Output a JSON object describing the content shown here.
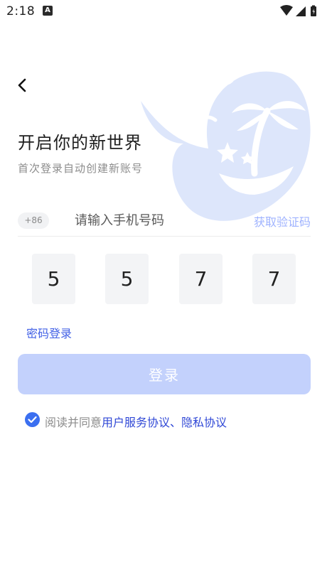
{
  "status_bar": {
    "time": "2:18",
    "notification_icon": "A"
  },
  "header": {
    "back_icon": "chevron-left-icon"
  },
  "page": {
    "title": "开启你的新世界",
    "subtitle": "首次登录自动创建新账号"
  },
  "phone": {
    "country_code": "+86",
    "placeholder": "请输入手机号码",
    "value": "",
    "get_code_label": "获取验证码"
  },
  "code_digits": [
    "5",
    "5",
    "7",
    "7"
  ],
  "password_login_label": "密码登录",
  "login_button_label": "登录",
  "agreement": {
    "checked": true,
    "prefix": "阅读并同意",
    "user_agreement": "用户服务协议",
    "separator": "、",
    "privacy_policy": "隐私协议"
  },
  "colors": {
    "accent": "#3b6ff0",
    "link": "#3048d6",
    "login_button_disabled": "#c3d1fc",
    "get_code": "#9fb3ff",
    "code_box_bg": "#f3f4f6",
    "whale_decoration": "#dde6fb"
  }
}
